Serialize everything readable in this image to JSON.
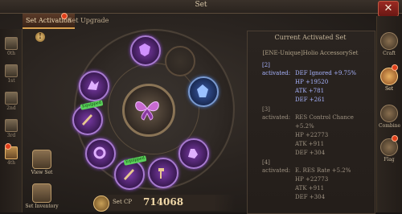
{
  "window": {
    "title": "Set"
  },
  "tabs": [
    {
      "label": "Set Activation",
      "active": true
    },
    {
      "label": "Set Upgrade",
      "active": false
    }
  ],
  "presets": [
    {
      "label": "0th"
    },
    {
      "label": "1st"
    },
    {
      "label": "2nd"
    },
    {
      "label": "3rd"
    },
    {
      "label": "4th",
      "active": true
    }
  ],
  "side_buttons": {
    "view_set": "View Set",
    "set_inventory": "Set Inventory"
  },
  "equipped_tags": [
    "Equipped",
    "Equipped"
  ],
  "set_cp": {
    "label": "Set CP",
    "value": "714068"
  },
  "panel": {
    "title": "Current Activated Set",
    "set_name": "[ENE-Unique]Holio AccessorySet",
    "bonuses": [
      {
        "count": "[2]",
        "status": "activated:",
        "lines": [
          "DEF Ignored +9.75%",
          "HP +19520",
          "ATK +781",
          "DEF +261"
        ]
      },
      {
        "count": "[3]",
        "status": "activated:",
        "lines": [
          "RES Control Chance",
          "+5.2%",
          "HP +22773",
          "ATK +911",
          "DEF +304"
        ]
      },
      {
        "count": "[4]",
        "status": "activated:",
        "lines": [
          "E. RES Rate +5.2%",
          "HP +22773",
          "ATK +911",
          "DEF +304"
        ]
      }
    ]
  },
  "right_nav": [
    {
      "label": "Craft"
    },
    {
      "label": "Set",
      "active": true
    },
    {
      "label": "Combine"
    },
    {
      "label": "Flag"
    }
  ],
  "colors": {
    "activated": "#a8b4ff",
    "inactive": "#9e9282",
    "accent": "#d8a050"
  }
}
